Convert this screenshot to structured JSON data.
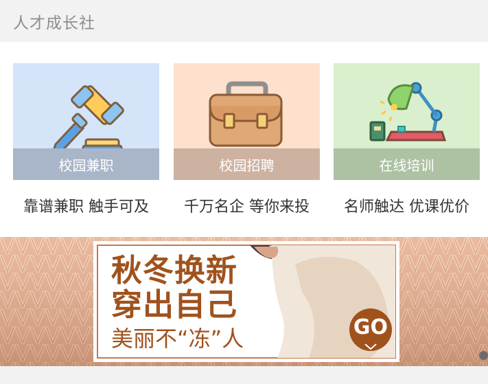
{
  "header": {
    "title": "人才成长社"
  },
  "cards": [
    {
      "label": "校园兼职",
      "tagline": "靠谱兼职 触手可及",
      "bg": "#d4e4f9",
      "bar": "#a9b5c8",
      "icon": "gavel-icon"
    },
    {
      "label": "校园招聘",
      "tagline": "千万名企  等你来投",
      "bg": "#fde1cd",
      "bar": "#ceb2a1",
      "icon": "briefcase-icon"
    },
    {
      "label": "在线培训",
      "tagline": "名师触达  优课优价",
      "bg": "#d9efcd",
      "bar": "#adc1a3",
      "icon": "desk-lamp-icon"
    }
  ],
  "banner": {
    "line1": "秋冬换新",
    "line2": "穿出自己",
    "line3": "美丽不“冻”人",
    "go_label": "GO",
    "accent": "#a0521c"
  }
}
